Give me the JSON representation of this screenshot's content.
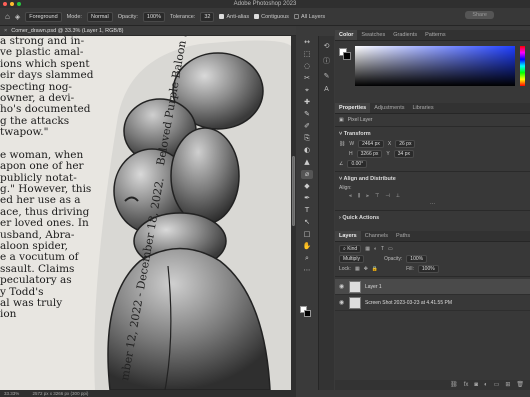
{
  "app": {
    "title": "Adobe Photoshop 2023"
  },
  "options": {
    "sample": "Foreground",
    "mode_label": "Mode:",
    "mode": "Normal",
    "opacity_label": "Opacity:",
    "opacity": "100%",
    "tolerance_label": "Tolerance:",
    "tolerance": "32",
    "antialias": "Anti-alias",
    "contiguous": "Contiguous",
    "all_layers": "All Layers",
    "share": "Share"
  },
  "doc": {
    "tab": "Comer_drawn.psd @ 33.3% (Layer 1, RGB/8)",
    "zoom": "33.33%",
    "size": "2572 px x 3266 px (300 ppi)"
  },
  "article": {
    "lines": [
      "a strong and in-",
      "ve plastic amal-",
      "ions which spent",
      "eir days slammed",
      "specting nog-",
      "owner, a devi-",
      "ho's documented",
      "g the attacks",
      "twapow.\"",
      "",
      "e woman, when",
      "apon one of her",
      "publicly notat-",
      "g.\" However, this",
      "ed her use as a",
      "ace, thus driving",
      "er loved ones. In",
      "usband, Abra-",
      "aloon spider,",
      "e a vocutum of",
      "ssault. Claims",
      "peculatory as",
      "y Todd's",
      "al was truly",
      "ion"
    ],
    "caption_a": "Beloved Purple Baloon Seahorse.",
    "caption_b": "mber 12, 2022 - December 18, 2022."
  },
  "tools": {
    "icons": [
      "↔",
      "⬚",
      "◌",
      "✂",
      "⌖",
      "✚",
      "✎",
      "✐",
      "⎘",
      "◐",
      "▲",
      "⌀",
      "◆",
      "✒",
      "T",
      "↖",
      "□",
      "✋",
      "⌕",
      "⋯"
    ]
  },
  "panels": {
    "color_tabs": [
      "Color",
      "Swatches",
      "Gradients",
      "Patterns"
    ],
    "props_tabs": [
      "Properties",
      "Adjustments",
      "Libraries"
    ],
    "pixel_layer": "Pixel Layer",
    "transform": "Transform",
    "w_label": "W",
    "w": "2464 px",
    "x_label": "X",
    "x": "26 px",
    "h_label": "H",
    "h": "3266 px",
    "y_label": "Y",
    "y": "34 px",
    "angle": "0.00°",
    "align": "Align and Distribute",
    "align_label": "Align:",
    "quick": "Quick Actions",
    "layers_tabs": [
      "Layers",
      "Channels",
      "Paths"
    ],
    "kind": "Kind",
    "blend": "Multiply",
    "opacity_label": "Opacity:",
    "opacity": "100%",
    "lock_label": "Lock:",
    "fill_label": "Fill:",
    "fill": "100%",
    "layers": [
      {
        "name": "Layer 1"
      },
      {
        "name": "Screen Shot 2023-03-23 at 4.41.55 PM"
      }
    ]
  },
  "colors": {
    "accent": "#1f3fff",
    "panel": "#383838",
    "canvas": "#e8e6e1"
  }
}
